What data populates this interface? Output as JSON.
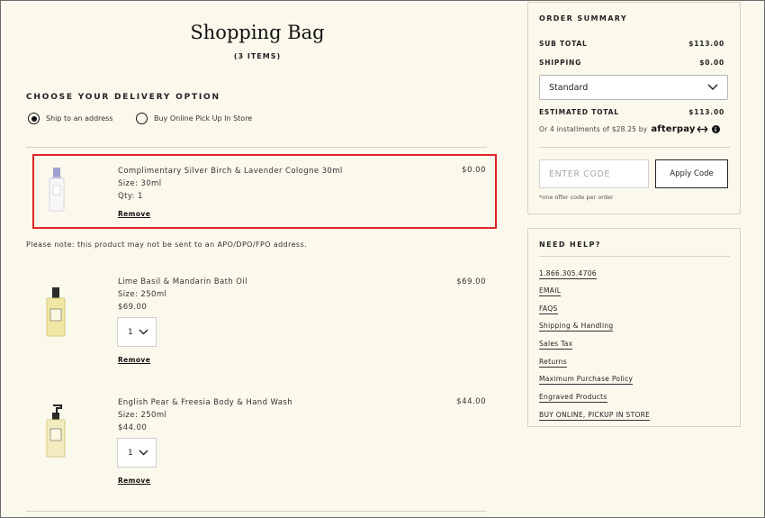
{
  "bag": {
    "title": "Shopping Bag",
    "items_count": "(3 ITEMS)"
  },
  "delivery": {
    "heading": "CHOOSE YOUR DELIVERY OPTION",
    "options": [
      {
        "label": "Ship to an address",
        "selected": true
      },
      {
        "label": "Buy Online Pick Up In Store",
        "selected": false
      }
    ]
  },
  "items": [
    {
      "name": "Complimentary Silver Birch & Lavender Cologne 30ml",
      "size": "Size: 30ml",
      "qty_text": "Qty: 1",
      "price": "$0.00",
      "remove": "Remove",
      "note": "Please note: this product may not be sent to an APO/DPO/FPO address."
    },
    {
      "name": "Lime Basil & Mandarin Bath Oil",
      "size": "Size: 250ml",
      "unit_price": "$69.00",
      "qty": "1",
      "price": "$69.00",
      "remove": "Remove"
    },
    {
      "name": "English Pear & Freesia Body & Hand Wash",
      "size": "Size: 250ml",
      "unit_price": "$44.00",
      "qty": "1",
      "price": "$44.00",
      "remove": "Remove"
    }
  ],
  "summary": {
    "heading": "ORDER SUMMARY",
    "subtotal_label": "SUB TOTAL",
    "subtotal": "$113.00",
    "shipping_label": "SHIPPING",
    "shipping": "$0.00",
    "shipping_method": "Standard",
    "estimated_label": "ESTIMATED TOTAL",
    "estimated": "$113.00",
    "installments": "Or 4 installments of $28.25 by",
    "afterpay": "afterpay",
    "code_placeholder": "ENTER CODE",
    "apply_label": "Apply Code",
    "code_note": "*one offer code per order"
  },
  "help": {
    "heading": "NEED HELP?",
    "links": [
      "1.866.305.4706",
      "EMAIL",
      "FAQS",
      "Shipping & Handling",
      "Sales Tax",
      "Returns",
      "Maximum Purchase Policy",
      "Engraved Products",
      "BUY ONLINE, PICKUP IN STORE"
    ]
  }
}
